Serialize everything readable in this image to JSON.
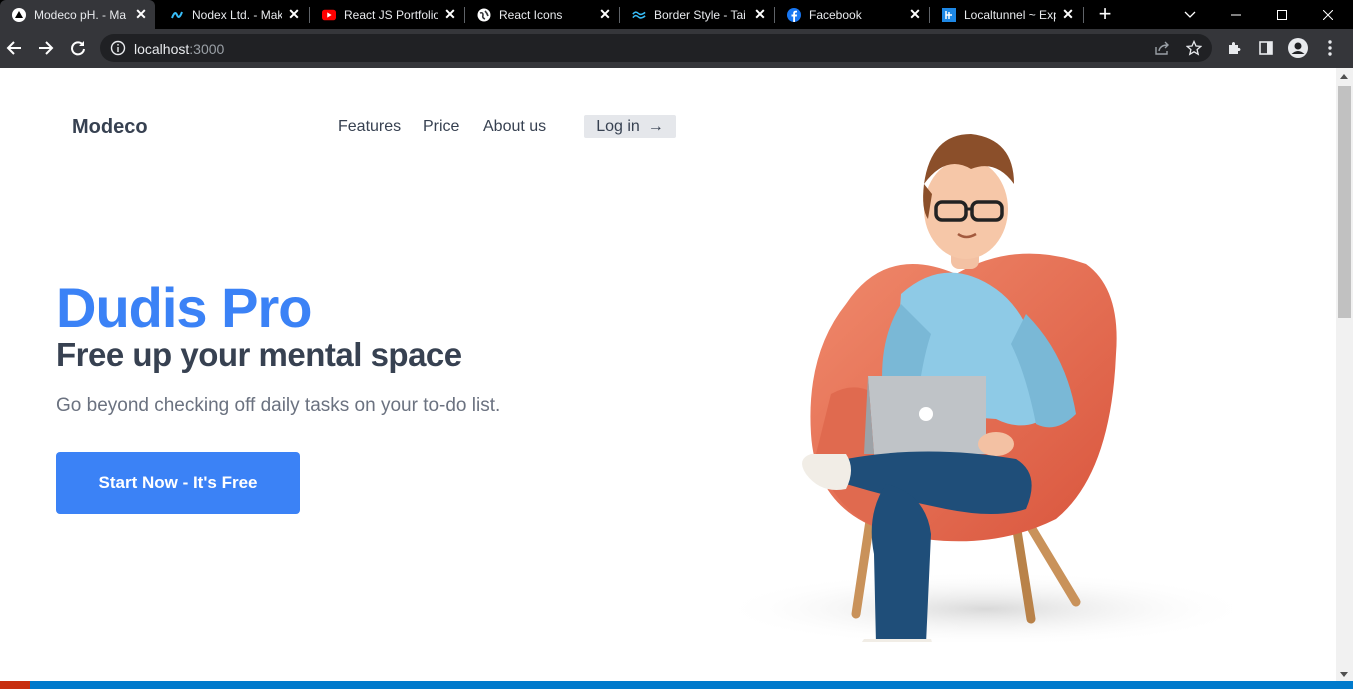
{
  "browser": {
    "tabs": [
      {
        "label": "Modeco pH. - Ma",
        "icon": "triangle-logo-icon",
        "active": true
      },
      {
        "label": "Nodex Ltd. - Mak",
        "icon": "nodex-logo-icon",
        "active": false
      },
      {
        "label": "React JS Portfolio",
        "icon": "youtube-icon",
        "active": false
      },
      {
        "label": "React Icons",
        "icon": "globe-icon",
        "active": false
      },
      {
        "label": "Border Style - Tai",
        "icon": "tailwind-icon",
        "active": false
      },
      {
        "label": "Facebook",
        "icon": "facebook-icon",
        "active": false
      },
      {
        "label": "Localtunnel ~ Exp",
        "icon": "localtunnel-icon",
        "active": false
      }
    ],
    "new_tab": "+",
    "url_host": "localhost",
    "url_port": ":3000"
  },
  "page": {
    "brand": "Modeco",
    "nav": [
      "Features",
      "Price",
      "About us"
    ],
    "login_label": "Log in",
    "login_arrow": "→",
    "hero_title": "Dudis Pro",
    "hero_subtitle": "Free up your mental space",
    "hero_description": "Go beyond checking off daily tasks on your to-do list.",
    "cta_label": "Start Now - It's Free"
  },
  "colors": {
    "accent": "#3b82f6",
    "heading": "#374151",
    "muted": "#6b7280",
    "chair": "#e8694f",
    "shirt": "#8ecae6",
    "jeans": "#1f4e79"
  }
}
